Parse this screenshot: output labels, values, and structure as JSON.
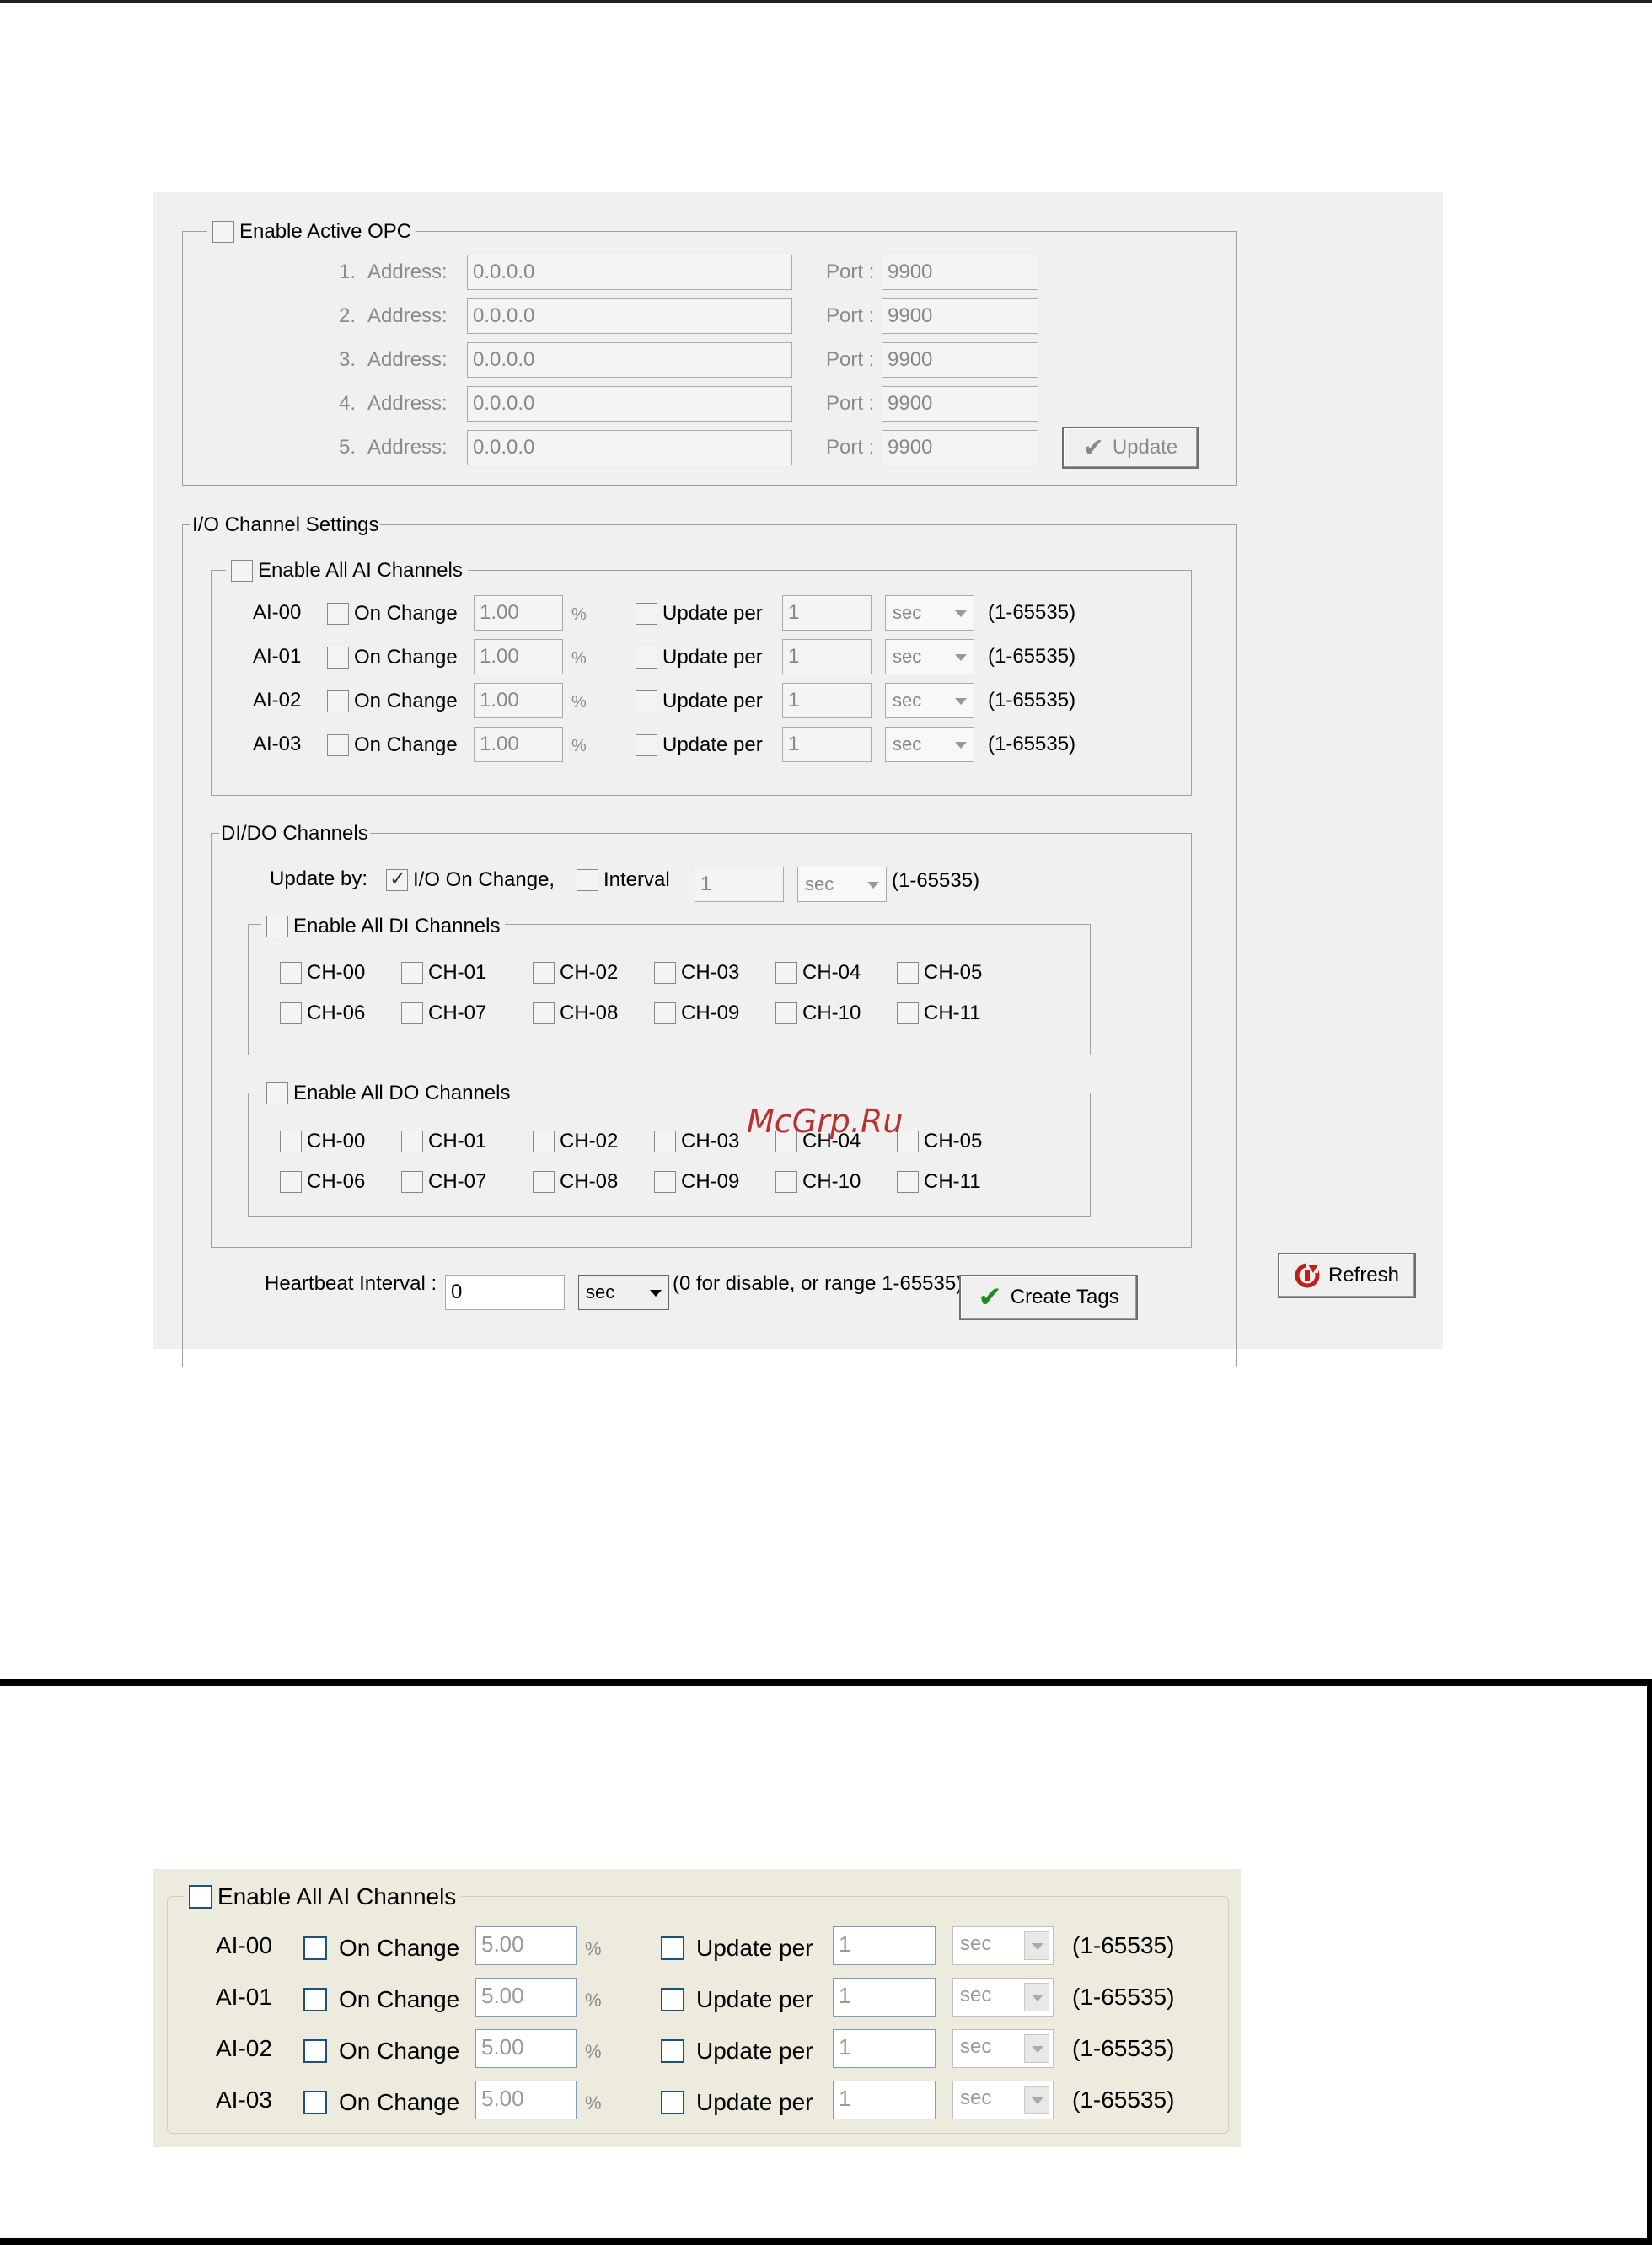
{
  "opc": {
    "enable_label": "Enable Active OPC",
    "address_label": "Address:",
    "port_label": "Port :",
    "rows": [
      {
        "num": "1.",
        "address": "0.0.0.0",
        "port": "9900"
      },
      {
        "num": "2.",
        "address": "0.0.0.0",
        "port": "9900"
      },
      {
        "num": "3.",
        "address": "0.0.0.0",
        "port": "9900"
      },
      {
        "num": "4.",
        "address": "0.0.0.0",
        "port": "9900"
      },
      {
        "num": "5.",
        "address": "0.0.0.0",
        "port": "9900"
      }
    ],
    "update_button": "Update"
  },
  "io": {
    "title": "I/O Channel Settings",
    "ai": {
      "enable_label": "Enable All AI Channels",
      "on_change_label": "On Change",
      "percent": "%",
      "update_per_label": "Update per",
      "range": "(1-65535)",
      "rows": [
        {
          "name": "AI-00",
          "threshold": "1.00",
          "interval": "1",
          "unit": "sec"
        },
        {
          "name": "AI-01",
          "threshold": "1.00",
          "interval": "1",
          "unit": "sec"
        },
        {
          "name": "AI-02",
          "threshold": "1.00",
          "interval": "1",
          "unit": "sec"
        },
        {
          "name": "AI-03",
          "threshold": "1.00",
          "interval": "1",
          "unit": "sec"
        }
      ]
    },
    "dido": {
      "title": "DI/DO Channels",
      "update_by_label": "Update by:",
      "io_on_change_label": "I/O On Change,",
      "io_on_change_checked": true,
      "interval_label": "Interval",
      "interval_value": "1",
      "interval_unit": "sec",
      "range": "(1-65535)",
      "di_enable_label": "Enable All DI Channels",
      "do_enable_label": "Enable All DO Channels",
      "channels": [
        "CH-00",
        "CH-01",
        "CH-02",
        "CH-03",
        "CH-04",
        "CH-05",
        "CH-06",
        "CH-07",
        "CH-08",
        "CH-09",
        "CH-10",
        "CH-11"
      ]
    },
    "heartbeat_label": "Heartbeat Interval :",
    "heartbeat_value": "0",
    "heartbeat_unit": "sec",
    "heartbeat_hint": "(0 for disable, or range 1-65535)",
    "create_tags_button": "Create Tags"
  },
  "refresh_button": "Refresh",
  "watermark": "McGrp.Ru",
  "ai_panel_2": {
    "enable_label": "Enable All AI Channels",
    "on_change_label": "On Change",
    "percent": "%",
    "update_per_label": "Update per",
    "range": "(1-65535)",
    "rows": [
      {
        "name": "AI-00",
        "threshold": "5.00",
        "interval": "1",
        "unit": "sec"
      },
      {
        "name": "AI-01",
        "threshold": "5.00",
        "interval": "1",
        "unit": "sec"
      },
      {
        "name": "AI-02",
        "threshold": "5.00",
        "interval": "1",
        "unit": "sec"
      },
      {
        "name": "AI-03",
        "threshold": "5.00",
        "interval": "1",
        "unit": "sec"
      }
    ]
  },
  "colors": {
    "panel_bg": "#f0f0f0",
    "panel2_bg": "#ecebde",
    "create_tags_check": "#1e8c1e",
    "refresh_icon": "#c0201a",
    "watermark": "#b83232"
  }
}
